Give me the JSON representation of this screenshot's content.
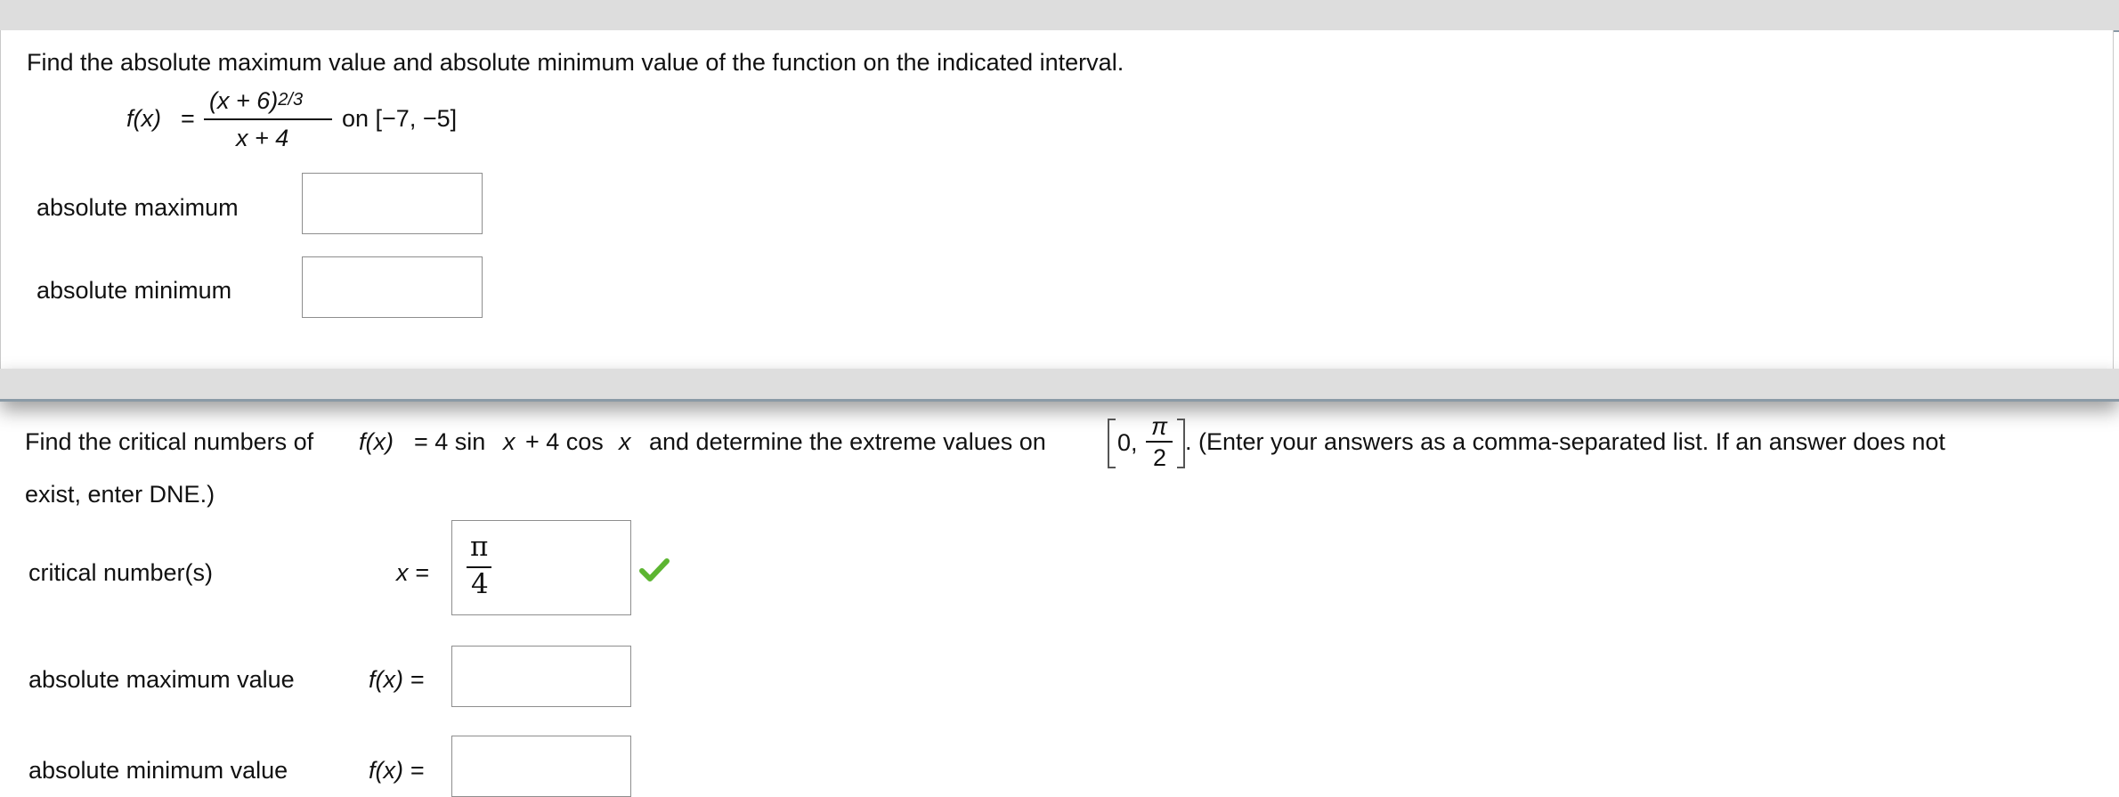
{
  "question1": {
    "prompt": "Find the absolute maximum value and absolute minimum value of the function on the indicated interval.",
    "function_lhs": "f(x)",
    "equals": "=",
    "numerator_base": "(x + 6)",
    "numerator_exponent": "2/3",
    "denominator": "x + 4",
    "interval": "on [−7, −5]",
    "abs_max_label": "absolute maximum",
    "abs_max_value": "",
    "abs_min_label": "absolute minimum",
    "abs_min_value": ""
  },
  "question2": {
    "prompt_start": "Find the critical numbers of",
    "function_text": "f(x)",
    "function_rest": "= 4 sin",
    "x1": "x",
    "plus_cos": "+ 4 cos",
    "x2": "x",
    "prompt_mid": "and determine the extreme values on",
    "interval_zero": "0,",
    "interval_num": "π",
    "interval_den": "2",
    "prompt_end": ". (Enter your answers as a comma-separated list. If an answer does not",
    "prompt_line2": "exist, enter DNE.)",
    "critical_label": "critical number(s)",
    "critical_var": "x =",
    "critical_answer_num": "π",
    "critical_answer_den": "4",
    "correct_icon": "checkmark-icon",
    "correct_color": "#5cb531",
    "max_label": "absolute maximum value",
    "max_var": "f(x) =",
    "max_value": "",
    "min_label": "absolute minimum value",
    "min_var": "f(x) =",
    "min_value": ""
  }
}
